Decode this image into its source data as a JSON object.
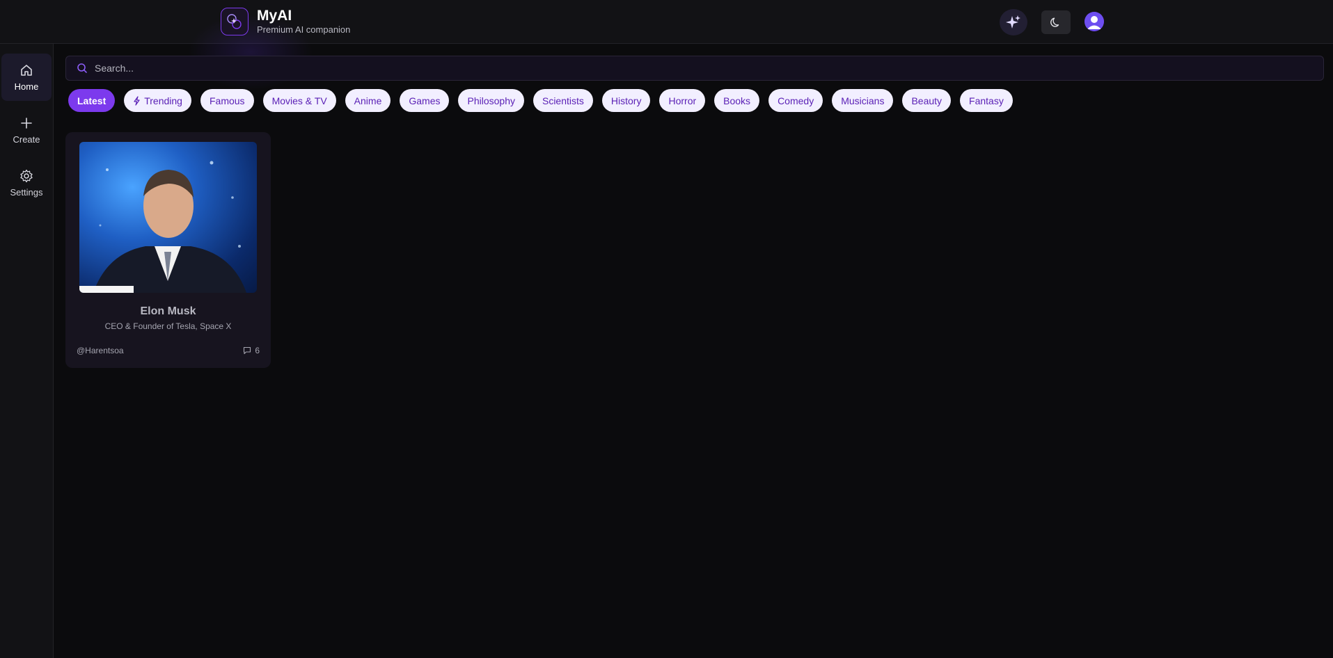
{
  "app": {
    "name": "MyAI",
    "tagline": "Premium AI companion"
  },
  "header": {
    "icons": [
      "sparkles-icon",
      "moon-icon",
      "user-avatar-icon"
    ]
  },
  "sidebar": {
    "items": [
      {
        "label": "Home",
        "icon": "home-icon",
        "active": true
      },
      {
        "label": "Create",
        "icon": "plus-icon",
        "active": false
      },
      {
        "label": "Settings",
        "icon": "gear-icon",
        "active": false
      }
    ]
  },
  "search": {
    "placeholder": "Search...",
    "value": ""
  },
  "categories": [
    {
      "label": "Latest",
      "active": true
    },
    {
      "label": "Trending",
      "icon": "bolt-icon"
    },
    {
      "label": "Famous"
    },
    {
      "label": "Movies & TV"
    },
    {
      "label": "Anime"
    },
    {
      "label": "Games"
    },
    {
      "label": "Philosophy"
    },
    {
      "label": "Scientists"
    },
    {
      "label": "History"
    },
    {
      "label": "Horror"
    },
    {
      "label": "Books"
    },
    {
      "label": "Comedy"
    },
    {
      "label": "Musicians"
    },
    {
      "label": "Beauty"
    },
    {
      "label": "Fantasy"
    }
  ],
  "companions": [
    {
      "name": "Elon Musk",
      "description": "CEO & Founder of Tesla, Space X",
      "author": "@Harentsoa",
      "messages": "6"
    }
  ],
  "colors": {
    "accent": "#7c3aed",
    "chip_bg": "#f2efff",
    "chip_text": "#5b21b6",
    "background": "#0b0b0d"
  }
}
